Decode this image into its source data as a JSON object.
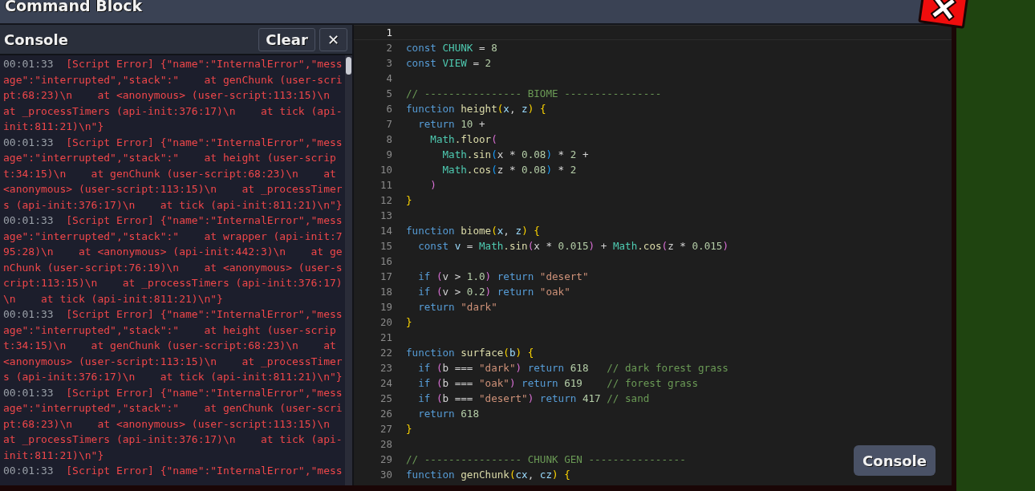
{
  "window": {
    "title": "Command Block"
  },
  "console": {
    "title": "Console",
    "clear_button": "Clear",
    "close_button": "✕",
    "entries": [
      {
        "time": "00:01:33",
        "message": "[Script Error] {\"name\":\"InternalError\",\"message\":\"interrupted\",\"stack\":\"    at genChunk (user-script:68:23)\\n    at <anonymous> (user-script:113:15)\\n    at _processTimers (api-init:376:17)\\n    at tick (api-init:811:21)\\n\"}"
      },
      {
        "time": "00:01:33",
        "message": "[Script Error] {\"name\":\"InternalError\",\"message\":\"interrupted\",\"stack\":\"    at height (user-script:34:15)\\n    at genChunk (user-script:68:23)\\n    at <anonymous> (user-script:113:15)\\n    at _processTimers (api-init:376:17)\\n    at tick (api-init:811:21)\\n\"}"
      },
      {
        "time": "00:01:33",
        "message": "[Script Error] {\"name\":\"InternalError\",\"message\":\"interrupted\",\"stack\":\"    at wrapper (api-init:795:28)\\n    at <anonymous> (api-init:442:3)\\n    at genChunk (user-script:76:19)\\n    at <anonymous> (user-script:113:15)\\n    at _processTimers (api-init:376:17)\\n    at tick (api-init:811:21)\\n\"}"
      },
      {
        "time": "00:01:33",
        "message": "[Script Error] {\"name\":\"InternalError\",\"message\":\"interrupted\",\"stack\":\"    at height (user-script:34:15)\\n    at genChunk (user-script:68:23)\\n    at <anonymous> (user-script:113:15)\\n    at _processTimers (api-init:376:17)\\n    at tick (api-init:811:21)\\n\"}"
      },
      {
        "time": "00:01:33",
        "message": "[Script Error] {\"name\":\"InternalError\",\"message\":\"interrupted\",\"stack\":\"    at genChunk (user-script:68:23)\\n    at <anonymous> (user-script:113:15)\\n    at _processTimers (api-init:376:17)\\n    at tick (api-init:811:21)\\n\"}"
      },
      {
        "time": "00:01:33",
        "message": "[Script Error] {\"name\":\"InternalError\",\"mess"
      }
    ]
  },
  "editor": {
    "lines": [
      {
        "number": "1",
        "active": true
      },
      {
        "number": "2",
        "active": false,
        "tokens": [
          {
            "kind": "keyword",
            "text": "const"
          },
          {
            "kind": "constant",
            "text": " CHUNK"
          },
          {
            "kind": "plain",
            "text": " ="
          },
          {
            "kind": "number",
            "text": " 8"
          }
        ]
      },
      {
        "number": "3",
        "active": false,
        "tokens": [
          {
            "kind": "keyword",
            "text": "const"
          },
          {
            "kind": "constant",
            "text": " VIEW"
          },
          {
            "kind": "plain",
            "text": " ="
          },
          {
            "kind": "number",
            "text": " 2"
          }
        ]
      },
      {
        "number": "4",
        "active": false
      },
      {
        "number": "5",
        "active": false,
        "tokens": [
          {
            "kind": "comment",
            "text": "// ---------------- BIOME ----------------"
          }
        ]
      },
      {
        "number": "6",
        "active": false,
        "tokens": [
          {
            "kind": "keyword",
            "text": "function"
          },
          {
            "kind": "function",
            "text": " height"
          },
          {
            "kind": "bracket1",
            "text": "("
          },
          {
            "kind": "param",
            "text": "x"
          },
          {
            "kind": "plain",
            "text": ","
          },
          {
            "kind": "param",
            "text": " z"
          },
          {
            "kind": "bracket1",
            "text": ")"
          },
          {
            "kind": "bracket1",
            "text": " {"
          }
        ]
      },
      {
        "number": "7",
        "active": false,
        "tokens": [
          {
            "kind": "keyword",
            "text": "  return"
          },
          {
            "kind": "number",
            "text": " 10"
          },
          {
            "kind": "plain",
            "text": " +"
          }
        ]
      },
      {
        "number": "8",
        "active": false,
        "tokens": [
          {
            "kind": "constant",
            "text": "    Math"
          },
          {
            "kind": "function",
            "text": ".floor"
          },
          {
            "kind": "bracket2",
            "text": "("
          }
        ]
      },
      {
        "number": "9",
        "active": false,
        "tokens": [
          {
            "kind": "constant",
            "text": "      Math"
          },
          {
            "kind": "function",
            "text": ".sin"
          },
          {
            "kind": "bracket3",
            "text": "("
          },
          {
            "kind": "plain",
            "text": "x *"
          },
          {
            "kind": "number",
            "text": " 0.08"
          },
          {
            "kind": "bracket3",
            "text": ")"
          },
          {
            "kind": "plain",
            "text": " *"
          },
          {
            "kind": "number",
            "text": " 2"
          },
          {
            "kind": "plain",
            "text": " +"
          }
        ]
      },
      {
        "number": "10",
        "active": false,
        "tokens": [
          {
            "kind": "constant",
            "text": "      Math"
          },
          {
            "kind": "function",
            "text": ".cos"
          },
          {
            "kind": "bracket3",
            "text": "("
          },
          {
            "kind": "plain",
            "text": "z *"
          },
          {
            "kind": "number",
            "text": " 0.08"
          },
          {
            "kind": "bracket3",
            "text": ")"
          },
          {
            "kind": "plain",
            "text": " *"
          },
          {
            "kind": "number",
            "text": " 2"
          }
        ]
      },
      {
        "number": "11",
        "active": false,
        "tokens": [
          {
            "kind": "bracket2",
            "text": "    )"
          }
        ]
      },
      {
        "number": "12",
        "active": false,
        "tokens": [
          {
            "kind": "bracket1",
            "text": "}"
          }
        ]
      },
      {
        "number": "13",
        "active": false
      },
      {
        "number": "14",
        "active": false,
        "tokens": [
          {
            "kind": "keyword",
            "text": "function"
          },
          {
            "kind": "function",
            "text": " biome"
          },
          {
            "kind": "bracket1",
            "text": "("
          },
          {
            "kind": "param",
            "text": "x"
          },
          {
            "kind": "plain",
            "text": ","
          },
          {
            "kind": "param",
            "text": " z"
          },
          {
            "kind": "bracket1",
            "text": ")"
          },
          {
            "kind": "bracket1",
            "text": " {"
          }
        ]
      },
      {
        "number": "15",
        "active": false,
        "tokens": [
          {
            "kind": "keyword",
            "text": "  const"
          },
          {
            "kind": "param",
            "text": " v"
          },
          {
            "kind": "plain",
            "text": " ="
          },
          {
            "kind": "constant",
            "text": " Math"
          },
          {
            "kind": "function",
            "text": ".sin"
          },
          {
            "kind": "bracket2",
            "text": "("
          },
          {
            "kind": "plain",
            "text": "x *"
          },
          {
            "kind": "number",
            "text": " 0.015"
          },
          {
            "kind": "bracket2",
            "text": ")"
          },
          {
            "kind": "plain",
            "text": " +"
          },
          {
            "kind": "constant",
            "text": " Math"
          },
          {
            "kind": "function",
            "text": ".cos"
          },
          {
            "kind": "bracket2",
            "text": "("
          },
          {
            "kind": "plain",
            "text": "z *"
          },
          {
            "kind": "number",
            "text": " 0.015"
          },
          {
            "kind": "bracket2",
            "text": ")"
          }
        ]
      },
      {
        "number": "16",
        "active": false
      },
      {
        "number": "17",
        "active": false,
        "tokens": [
          {
            "kind": "keyword",
            "text": "  if"
          },
          {
            "kind": "bracket2",
            "text": " ("
          },
          {
            "kind": "plain",
            "text": "v >"
          },
          {
            "kind": "number",
            "text": " 1.0"
          },
          {
            "kind": "bracket2",
            "text": ")"
          },
          {
            "kind": "keyword",
            "text": " return"
          },
          {
            "kind": "string",
            "text": " \"desert\""
          }
        ]
      },
      {
        "number": "18",
        "active": false,
        "tokens": [
          {
            "kind": "keyword",
            "text": "  if"
          },
          {
            "kind": "bracket2",
            "text": " ("
          },
          {
            "kind": "plain",
            "text": "v >"
          },
          {
            "kind": "number",
            "text": " 0.2"
          },
          {
            "kind": "bracket2",
            "text": ")"
          },
          {
            "kind": "keyword",
            "text": " return"
          },
          {
            "kind": "string",
            "text": " \"oak\""
          }
        ]
      },
      {
        "number": "19",
        "active": false,
        "tokens": [
          {
            "kind": "keyword",
            "text": "  return"
          },
          {
            "kind": "string",
            "text": " \"dark\""
          }
        ]
      },
      {
        "number": "20",
        "active": false,
        "tokens": [
          {
            "kind": "bracket1",
            "text": "}"
          }
        ]
      },
      {
        "number": "21",
        "active": false
      },
      {
        "number": "22",
        "active": false,
        "tokens": [
          {
            "kind": "keyword",
            "text": "function"
          },
          {
            "kind": "function",
            "text": " surface"
          },
          {
            "kind": "bracket1",
            "text": "("
          },
          {
            "kind": "param",
            "text": "b"
          },
          {
            "kind": "bracket1",
            "text": ")"
          },
          {
            "kind": "bracket1",
            "text": " {"
          }
        ]
      },
      {
        "number": "23",
        "active": false,
        "tokens": [
          {
            "kind": "keyword",
            "text": "  if"
          },
          {
            "kind": "bracket2",
            "text": " ("
          },
          {
            "kind": "plain",
            "text": "b ==="
          },
          {
            "kind": "string",
            "text": " \"dark\""
          },
          {
            "kind": "bracket2",
            "text": ")"
          },
          {
            "kind": "keyword",
            "text": " return"
          },
          {
            "kind": "number",
            "text": " 618"
          },
          {
            "kind": "comment",
            "text": "   // dark forest grass"
          }
        ]
      },
      {
        "number": "24",
        "active": false,
        "tokens": [
          {
            "kind": "keyword",
            "text": "  if"
          },
          {
            "kind": "bracket2",
            "text": " ("
          },
          {
            "kind": "plain",
            "text": "b ==="
          },
          {
            "kind": "string",
            "text": " \"oak\""
          },
          {
            "kind": "bracket2",
            "text": ")"
          },
          {
            "kind": "keyword",
            "text": " return"
          },
          {
            "kind": "number",
            "text": " 619"
          },
          {
            "kind": "comment",
            "text": "    // forest grass"
          }
        ]
      },
      {
        "number": "25",
        "active": false,
        "tokens": [
          {
            "kind": "keyword",
            "text": "  if"
          },
          {
            "kind": "bracket2",
            "text": " ("
          },
          {
            "kind": "plain",
            "text": "b ==="
          },
          {
            "kind": "string",
            "text": " \"desert\""
          },
          {
            "kind": "bracket2",
            "text": ")"
          },
          {
            "kind": "keyword",
            "text": " return"
          },
          {
            "kind": "number",
            "text": " 417"
          },
          {
            "kind": "comment",
            "text": " // sand"
          }
        ]
      },
      {
        "number": "26",
        "active": false,
        "tokens": [
          {
            "kind": "keyword",
            "text": "  return"
          },
          {
            "kind": "number",
            "text": " 618"
          }
        ]
      },
      {
        "number": "27",
        "active": false,
        "tokens": [
          {
            "kind": "bracket1",
            "text": "}"
          }
        ]
      },
      {
        "number": "28",
        "active": false
      },
      {
        "number": "29",
        "active": false,
        "tokens": [
          {
            "kind": "comment",
            "text": "// ---------------- CHUNK GEN ----------------"
          }
        ]
      },
      {
        "number": "30",
        "active": false,
        "tokens": [
          {
            "kind": "keyword",
            "text": "function"
          },
          {
            "kind": "function",
            "text": " genChunk"
          },
          {
            "kind": "bracket1",
            "text": "("
          },
          {
            "kind": "param",
            "text": "cx"
          },
          {
            "kind": "plain",
            "text": ","
          },
          {
            "kind": "param",
            "text": " cz"
          },
          {
            "kind": "bracket1",
            "text": ")"
          },
          {
            "kind": "bracket1",
            "text": " {"
          }
        ]
      }
    ]
  },
  "console_toggle_button": "Console"
}
